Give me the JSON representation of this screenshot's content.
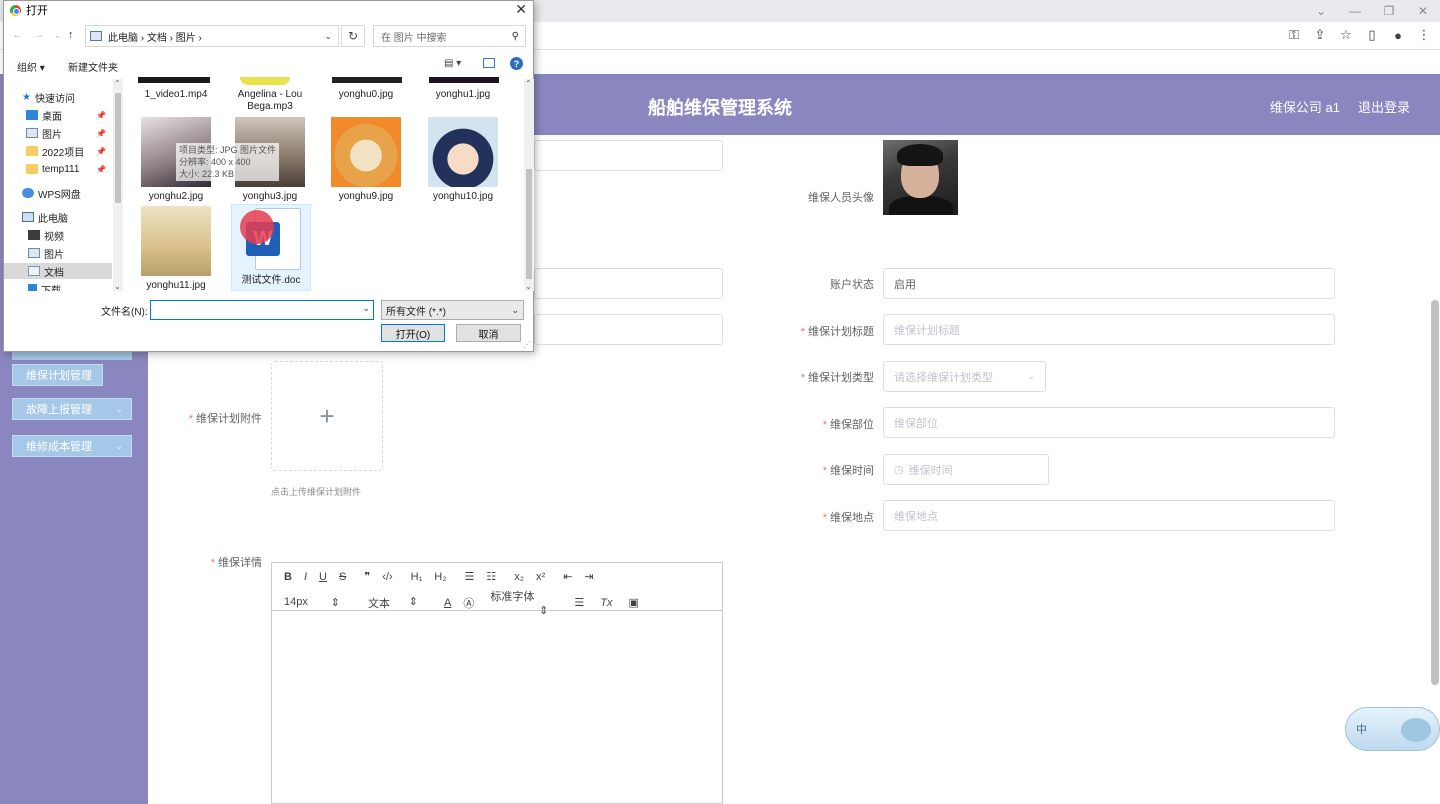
{
  "browser": {
    "window_controls": [
      "⌄",
      "—",
      "❐",
      "✕"
    ],
    "toolbar_icons": [
      "⚿",
      "⇪",
      "☆",
      "▯",
      "●",
      "⋮"
    ]
  },
  "app": {
    "title": "船舶维保管理系统",
    "user_label": "维保公司 a1",
    "logout": "退出登录"
  },
  "sidebar": {
    "items": [
      {
        "label": "维保计划管理",
        "chevron": ""
      },
      {
        "label": "故障上报管理",
        "chevron": "⌄"
      },
      {
        "label": "维修成本管理",
        "chevron": "⌄"
      }
    ]
  },
  "form": {
    "avatar_label": "维保人员头像",
    "account_status_label": "账户状态",
    "account_status_value": "启用",
    "plan_title_label": "维保计划标题",
    "plan_title_placeholder": "维保计划标题",
    "plan_type_label": "维保计划类型",
    "plan_type_placeholder": "请选择维保计划类型",
    "department_label": "维保部位",
    "department_placeholder": "维保部位",
    "time_label": "维保时间",
    "time_placeholder": "维保时间",
    "location_label": "维保地点",
    "location_placeholder": "维保地点",
    "attachment_label": "维保计划附件",
    "upload_plus": "+",
    "upload_hint": "点击上传维保计划附件",
    "detail_label": "维保详情"
  },
  "editor": {
    "row1": [
      "B",
      "I",
      "U",
      "S",
      "❞",
      "‹/›",
      "H₁",
      "H₂",
      "☰",
      "☷",
      "x₂",
      "x²",
      "⇤",
      "⇥"
    ],
    "font_size": "14px",
    "text_type": "文本",
    "font_family": "标准字体",
    "align": "☰",
    "clear": "Tx",
    "image": "▣"
  },
  "dialog": {
    "title": "打开",
    "close": "✕",
    "breadcrumb": "此电脑  ›  文档  ›  图片  ›",
    "search_placeholder": "在 图片 中搜索",
    "organize": "组织 ▾",
    "new_folder": "新建文件夹",
    "tree": [
      {
        "label": "快速访问",
        "icon": "star",
        "pin": false
      },
      {
        "label": "桌面",
        "icon": "blue",
        "pin": true
      },
      {
        "label": "图片",
        "icon": "pic",
        "pin": true
      },
      {
        "label": "2022项目",
        "icon": "folder",
        "pin": true
      },
      {
        "label": "temp111",
        "icon": "folder",
        "pin": true
      },
      {
        "label": "WPS网盘",
        "icon": "cloud",
        "pin": false
      },
      {
        "label": "此电脑",
        "icon": "pc",
        "pin": false
      },
      {
        "label": "视频",
        "icon": "video",
        "pin": false
      },
      {
        "label": "图片",
        "icon": "pic",
        "pin": false
      },
      {
        "label": "文档",
        "icon": "doc",
        "pin": false
      },
      {
        "label": "下载",
        "icon": "dl",
        "pin": false
      }
    ],
    "files": [
      {
        "name": "1_video1.mp4"
      },
      {
        "name": "Angelina - Lou Bega.mp3"
      },
      {
        "name": "yonghu0.jpg"
      },
      {
        "name": "yonghu1.jpg"
      },
      {
        "name": "yonghu2.jpg"
      },
      {
        "name": "yonghu3.jpg"
      },
      {
        "name": "yonghu9.jpg"
      },
      {
        "name": "yonghu10.jpg"
      },
      {
        "name": "yonghu11.jpg"
      },
      {
        "name": "测试文件.doc"
      }
    ],
    "tooltip": [
      "项目类型: JPG 图片文件",
      "分辨率: 400 x 400",
      "大小: 22.3 KB"
    ],
    "filename_label": "文件名(N):",
    "filename_value": "",
    "filetype": "所有文件 (*.*)",
    "open_button": "打开(O)",
    "cancel_button": "取消"
  },
  "ime": {
    "label": "中"
  }
}
